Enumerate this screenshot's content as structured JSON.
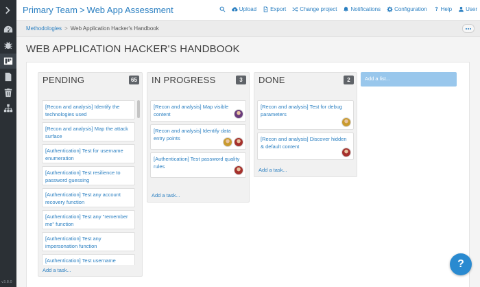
{
  "header": {
    "team": "Primary Team",
    "separator": ">",
    "project": "Web App Assessment",
    "nav": [
      {
        "label": "",
        "icon": "search-icon"
      },
      {
        "label": "Upload",
        "icon": "cloud-upload-icon"
      },
      {
        "label": "Export",
        "icon": "document-export-icon"
      },
      {
        "label": "Change project",
        "icon": "shuffle-icon"
      },
      {
        "label": "Notifications",
        "icon": "bell-icon"
      },
      {
        "label": "Configuration",
        "icon": "gear-icon"
      },
      {
        "label": "Help",
        "icon": "question-icon"
      },
      {
        "label": "User",
        "icon": "user-icon"
      }
    ]
  },
  "rail": {
    "version": "v3.8.0",
    "items": [
      "chevron-right-icon",
      "dashboard-icon",
      "bug-icon",
      "board-icon",
      "document-icon",
      "trash-icon",
      "sitemap-icon"
    ]
  },
  "breadcrumb": {
    "link": "Methodologies",
    "separator": ">",
    "current": "Web Application Hacker's Handbook"
  },
  "page": {
    "title": "WEB APPLICATION HACKER'S HANDBOOK"
  },
  "lists": [
    {
      "title": "PENDING",
      "count": "65",
      "cards": [
        {
          "text": "[Recon and analysis] Identify the technologies used",
          "avatars": []
        },
        {
          "text": "[Recon and analysis] Map the attack surface",
          "avatars": []
        },
        {
          "text": "[Authentication] Test for username enumeration",
          "avatars": []
        },
        {
          "text": "[Authentication] Test resilience to password guessing",
          "avatars": []
        },
        {
          "text": "[Authentication] Test any account recovery function",
          "avatars": []
        },
        {
          "text": "[Authentication] Test any \"remember me\" function",
          "avatars": []
        },
        {
          "text": "[Authentication] Test any impersonation function",
          "avatars": []
        },
        {
          "text": "[Authentication] Test username uniqueness",
          "avatars": []
        }
      ],
      "add_task": "Add a task..."
    },
    {
      "title": "IN PROGRESS",
      "count": "3",
      "cards": [
        {
          "text": "[Recon and analysis] Map visible content",
          "avatars": [
            "purple"
          ]
        },
        {
          "text": "[Recon and analysis] Identify data entry points",
          "avatars": [
            "gold",
            "red"
          ]
        },
        {
          "text": "[Authentication] Test password quality rules",
          "avatars": [
            "red"
          ]
        }
      ],
      "add_task": "Add a task..."
    },
    {
      "title": "DONE",
      "count": "2",
      "cards": [
        {
          "text": "[Recon and analysis] Test for debug parameters",
          "avatars": [
            "gold"
          ]
        },
        {
          "text": "[Recon and analysis] Discover hidden & default content",
          "avatars": [
            "red"
          ]
        }
      ],
      "add_task": "Add a task..."
    }
  ],
  "add_list": {
    "placeholder": "Add a list..."
  },
  "help_fab": {
    "label": "?"
  },
  "colors": {
    "accent": "#2a7fc1",
    "rail": "#2b3035",
    "count_badge": "#5f6368",
    "add_list": "#99c7ec",
    "avatar_purple": "#6a3b7c",
    "avatar_gold": "#c99a2e",
    "avatar_red": "#a5302c"
  }
}
